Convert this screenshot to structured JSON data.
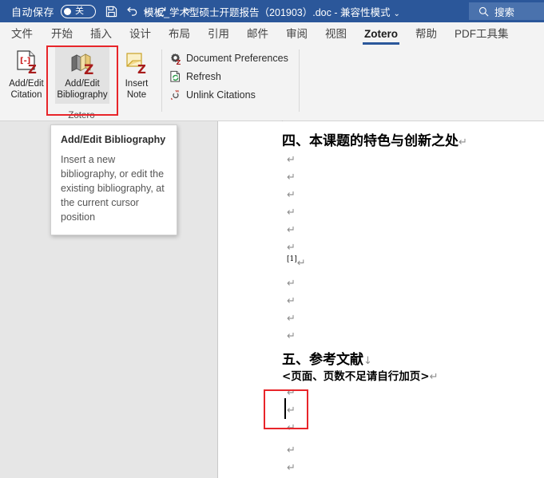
{
  "titlebar": {
    "autosave_label": "自动保存",
    "autosave_state": "关",
    "save_icon": "save-icon",
    "undo_icon": "undo-icon",
    "redo_icon": "redo-icon",
    "customize_icon": "customize-quick-access-icon",
    "document_title": "模板_学术型硕士开题报告（201903）.doc - 兼容性模式",
    "title_chevron": "⌄",
    "search_icon": "search-icon",
    "search_placeholder": "搜索",
    "accent_color": "#2b579a"
  },
  "tabs": [
    {
      "label": "文件",
      "active": false
    },
    {
      "label": "开始",
      "active": false
    },
    {
      "label": "插入",
      "active": false
    },
    {
      "label": "设计",
      "active": false
    },
    {
      "label": "布局",
      "active": false
    },
    {
      "label": "引用",
      "active": false
    },
    {
      "label": "邮件",
      "active": false
    },
    {
      "label": "审阅",
      "active": false
    },
    {
      "label": "视图",
      "active": false
    },
    {
      "label": "Zotero",
      "active": true
    },
    {
      "label": "帮助",
      "active": false
    },
    {
      "label": "PDF工具集",
      "active": false
    }
  ],
  "ribbon": {
    "group_label": "Zotero",
    "buttons": [
      {
        "label_line1": "Add/Edit",
        "label_line2": "Citation",
        "icon": "add-edit-citation-icon",
        "selected": false
      },
      {
        "label_line1": "Add/Edit",
        "label_line2": "Bibliography",
        "icon": "add-edit-bibliography-icon",
        "selected": true
      },
      {
        "label_line1": "Insert",
        "label_line2": "Note",
        "icon": "insert-note-icon",
        "selected": false
      }
    ],
    "commands": [
      {
        "label": "Document Preferences",
        "icon": "document-preferences-icon"
      },
      {
        "label": "Refresh",
        "icon": "refresh-icon"
      },
      {
        "label": "Unlink Citations",
        "icon": "unlink-citations-icon"
      }
    ],
    "highlight_color": "#e8252a"
  },
  "tooltip": {
    "title": "Add/Edit Bibliography",
    "body": "Insert a new bibliography, or edit the existing bibliography, at the current cursor position"
  },
  "document": {
    "heading_4": "四、本课题的特色与创新之处",
    "heading_5": "五、参考文献",
    "subtitle_5": "<页面、页数不足请自行加页>",
    "citation_marker": "[1]",
    "paragraph_mark": "↵",
    "linebreak_mark": "↓",
    "cursor_highlight_color": "#e8252a"
  }
}
